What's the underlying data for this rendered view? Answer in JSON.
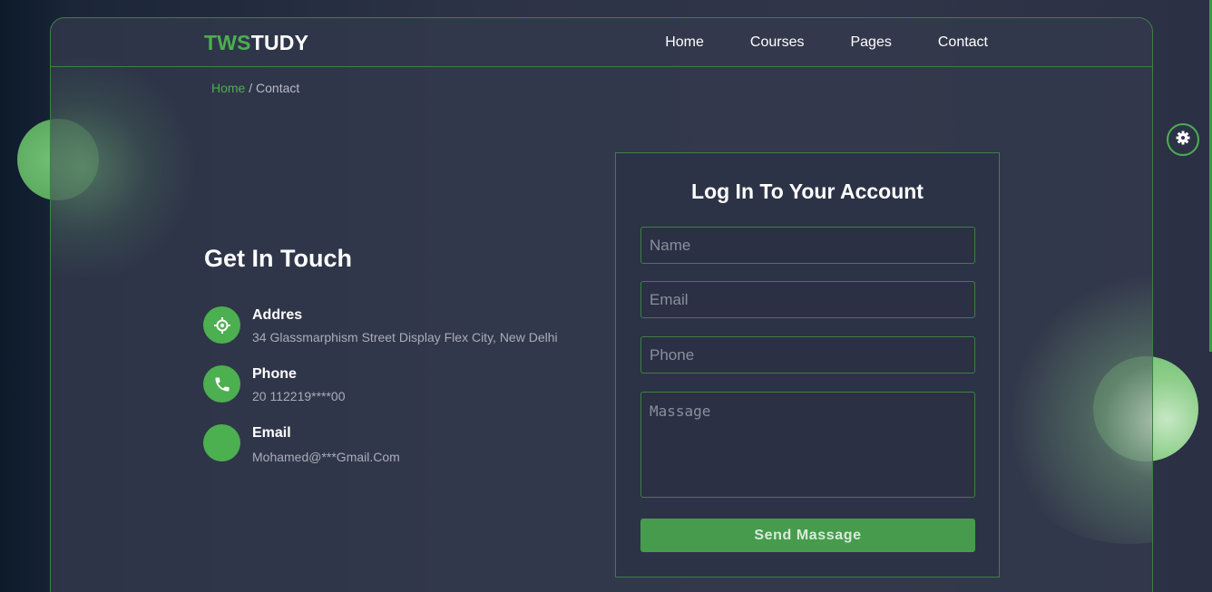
{
  "brand": {
    "part1": "TWS",
    "part2": "TUDY"
  },
  "nav": [
    {
      "label": "Home"
    },
    {
      "label": "Courses"
    },
    {
      "label": "Pages"
    },
    {
      "label": "Contact"
    }
  ],
  "breadcrumb": {
    "home": "Home",
    "separator": " / ",
    "current": "Contact"
  },
  "contact": {
    "title": "Get In Touch",
    "items": [
      {
        "label": "Addres",
        "value": "34 Glassmarphism Street Display Flex City, New Delhi",
        "icon": "location-icon"
      },
      {
        "label": "Phone",
        "value": "20 112219****00",
        "icon": "phone-icon"
      },
      {
        "label": "Email",
        "value": "Mohamed@***Gmail.Com",
        "icon": "email-icon"
      }
    ]
  },
  "form": {
    "title": "Log In To Your Account",
    "name_placeholder": "Name",
    "email_placeholder": "Email",
    "phone_placeholder": "Phone",
    "message_placeholder": "Massage",
    "submit_label": "Send Massage"
  },
  "settings": {
    "icon": "gear-icon"
  },
  "colors": {
    "accent": "#4caf50",
    "background": "#2d3347",
    "border": "#3d7f45",
    "button": "#479b4c"
  }
}
